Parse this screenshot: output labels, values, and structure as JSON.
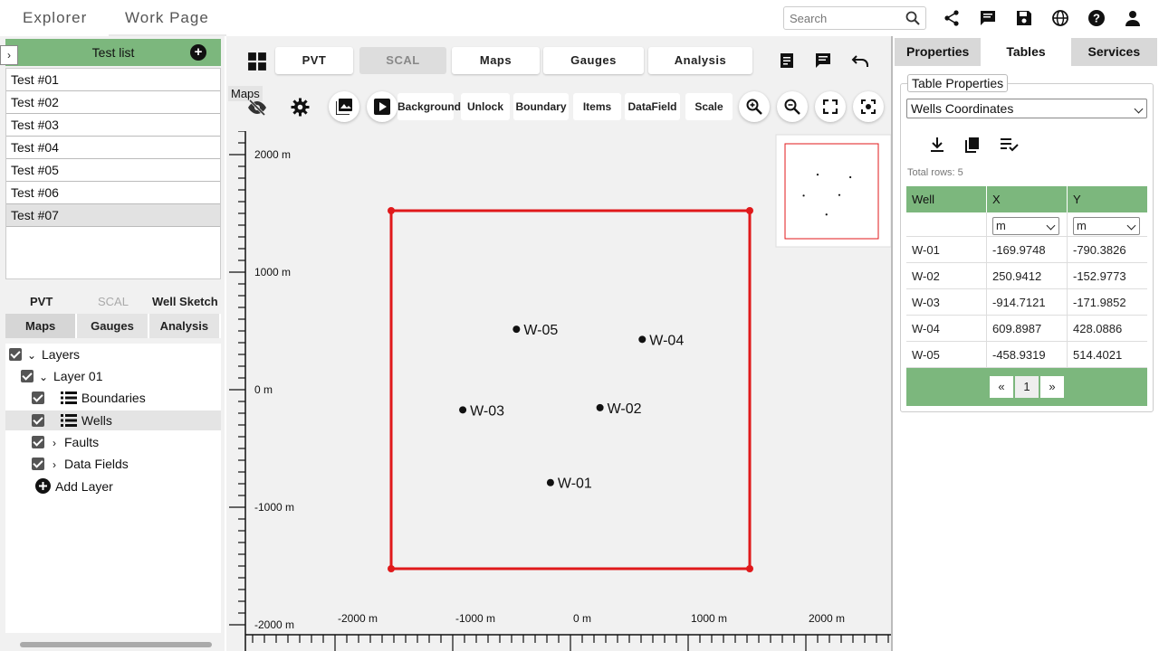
{
  "topnav": {
    "tabs": [
      "Explorer",
      "Work Page"
    ],
    "search_placeholder": "Search"
  },
  "test_list": {
    "header": "Test list",
    "items": [
      "Test #01",
      "Test #02",
      "Test #03",
      "Test #04",
      "Test #05",
      "Test #06",
      "Test #07"
    ],
    "selected": "Test #07"
  },
  "left_nav": {
    "row1": [
      "PVT",
      "SCAL",
      "Well Sketch"
    ],
    "row2": [
      "Maps",
      "Gauges",
      "Analysis"
    ]
  },
  "layers": {
    "root": "Layers",
    "layer": "Layer 01",
    "children": [
      "Boundaries",
      "Wells",
      "Faults",
      "Data Fields"
    ],
    "add": "Add Layer"
  },
  "toolbar": {
    "tabs": [
      "PVT",
      "SCAL",
      "Maps",
      "Gauges",
      "Analysis"
    ],
    "tools": [
      "Background",
      "Unlock",
      "Boundary",
      "Items",
      "DataField",
      "Scale"
    ],
    "maps_label": "Maps"
  },
  "map": {
    "y_labels": [
      "2000 m",
      "1000 m",
      "0 m",
      "-1000 m",
      "-2000 m"
    ],
    "x_labels": [
      "-2000 m",
      "-1000 m",
      "0 m",
      "1000 m",
      "2000 m"
    ],
    "wells": [
      {
        "name": "W-01",
        "x": -169.9748,
        "y": -790.3826
      },
      {
        "name": "W-02",
        "x": 250.9412,
        "y": -152.9773
      },
      {
        "name": "W-03",
        "x": -914.7121,
        "y": -171.9852
      },
      {
        "name": "W-04",
        "x": 609.8987,
        "y": 428.0886
      },
      {
        "name": "W-05",
        "x": -458.9319,
        "y": 514.4021
      }
    ],
    "boundary_color": "#e0191b"
  },
  "right": {
    "tabs": [
      "Properties",
      "Tables",
      "Services"
    ],
    "legend": "Table Properties",
    "table_select": "Wells Coordinates",
    "total_rows": "Total rows: 5",
    "columns": [
      "Well",
      "X",
      "Y"
    ],
    "units": [
      "m",
      "m"
    ],
    "rows": [
      [
        "W-01",
        "-169.9748",
        "-790.3826"
      ],
      [
        "W-02",
        "250.9412",
        "-152.9773"
      ],
      [
        "W-03",
        "-914.7121",
        "-171.9852"
      ],
      [
        "W-04",
        "609.8987",
        "428.0886"
      ],
      [
        "W-05",
        "-458.9319",
        "514.4021"
      ]
    ],
    "pager": [
      "«",
      "1",
      "»"
    ]
  },
  "colors": {
    "accent_green": "#7cb77d",
    "boundary_red": "#e0191b"
  }
}
